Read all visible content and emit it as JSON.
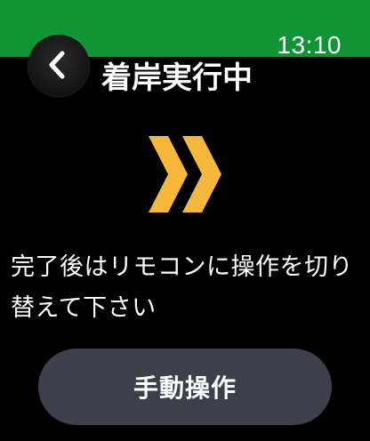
{
  "status_bar": {
    "time": "13:10",
    "color": "#119433"
  },
  "header": {
    "title": "着岸実行中",
    "back_icon": "chevron-left-icon"
  },
  "indicator": {
    "icon": "double-chevron-right-icon",
    "color": "#F5B83A"
  },
  "message": "完了後はリモコンに操作を切り替えて下さい",
  "actions": {
    "manual_label": "手動操作",
    "button_color": "#3D404A"
  }
}
